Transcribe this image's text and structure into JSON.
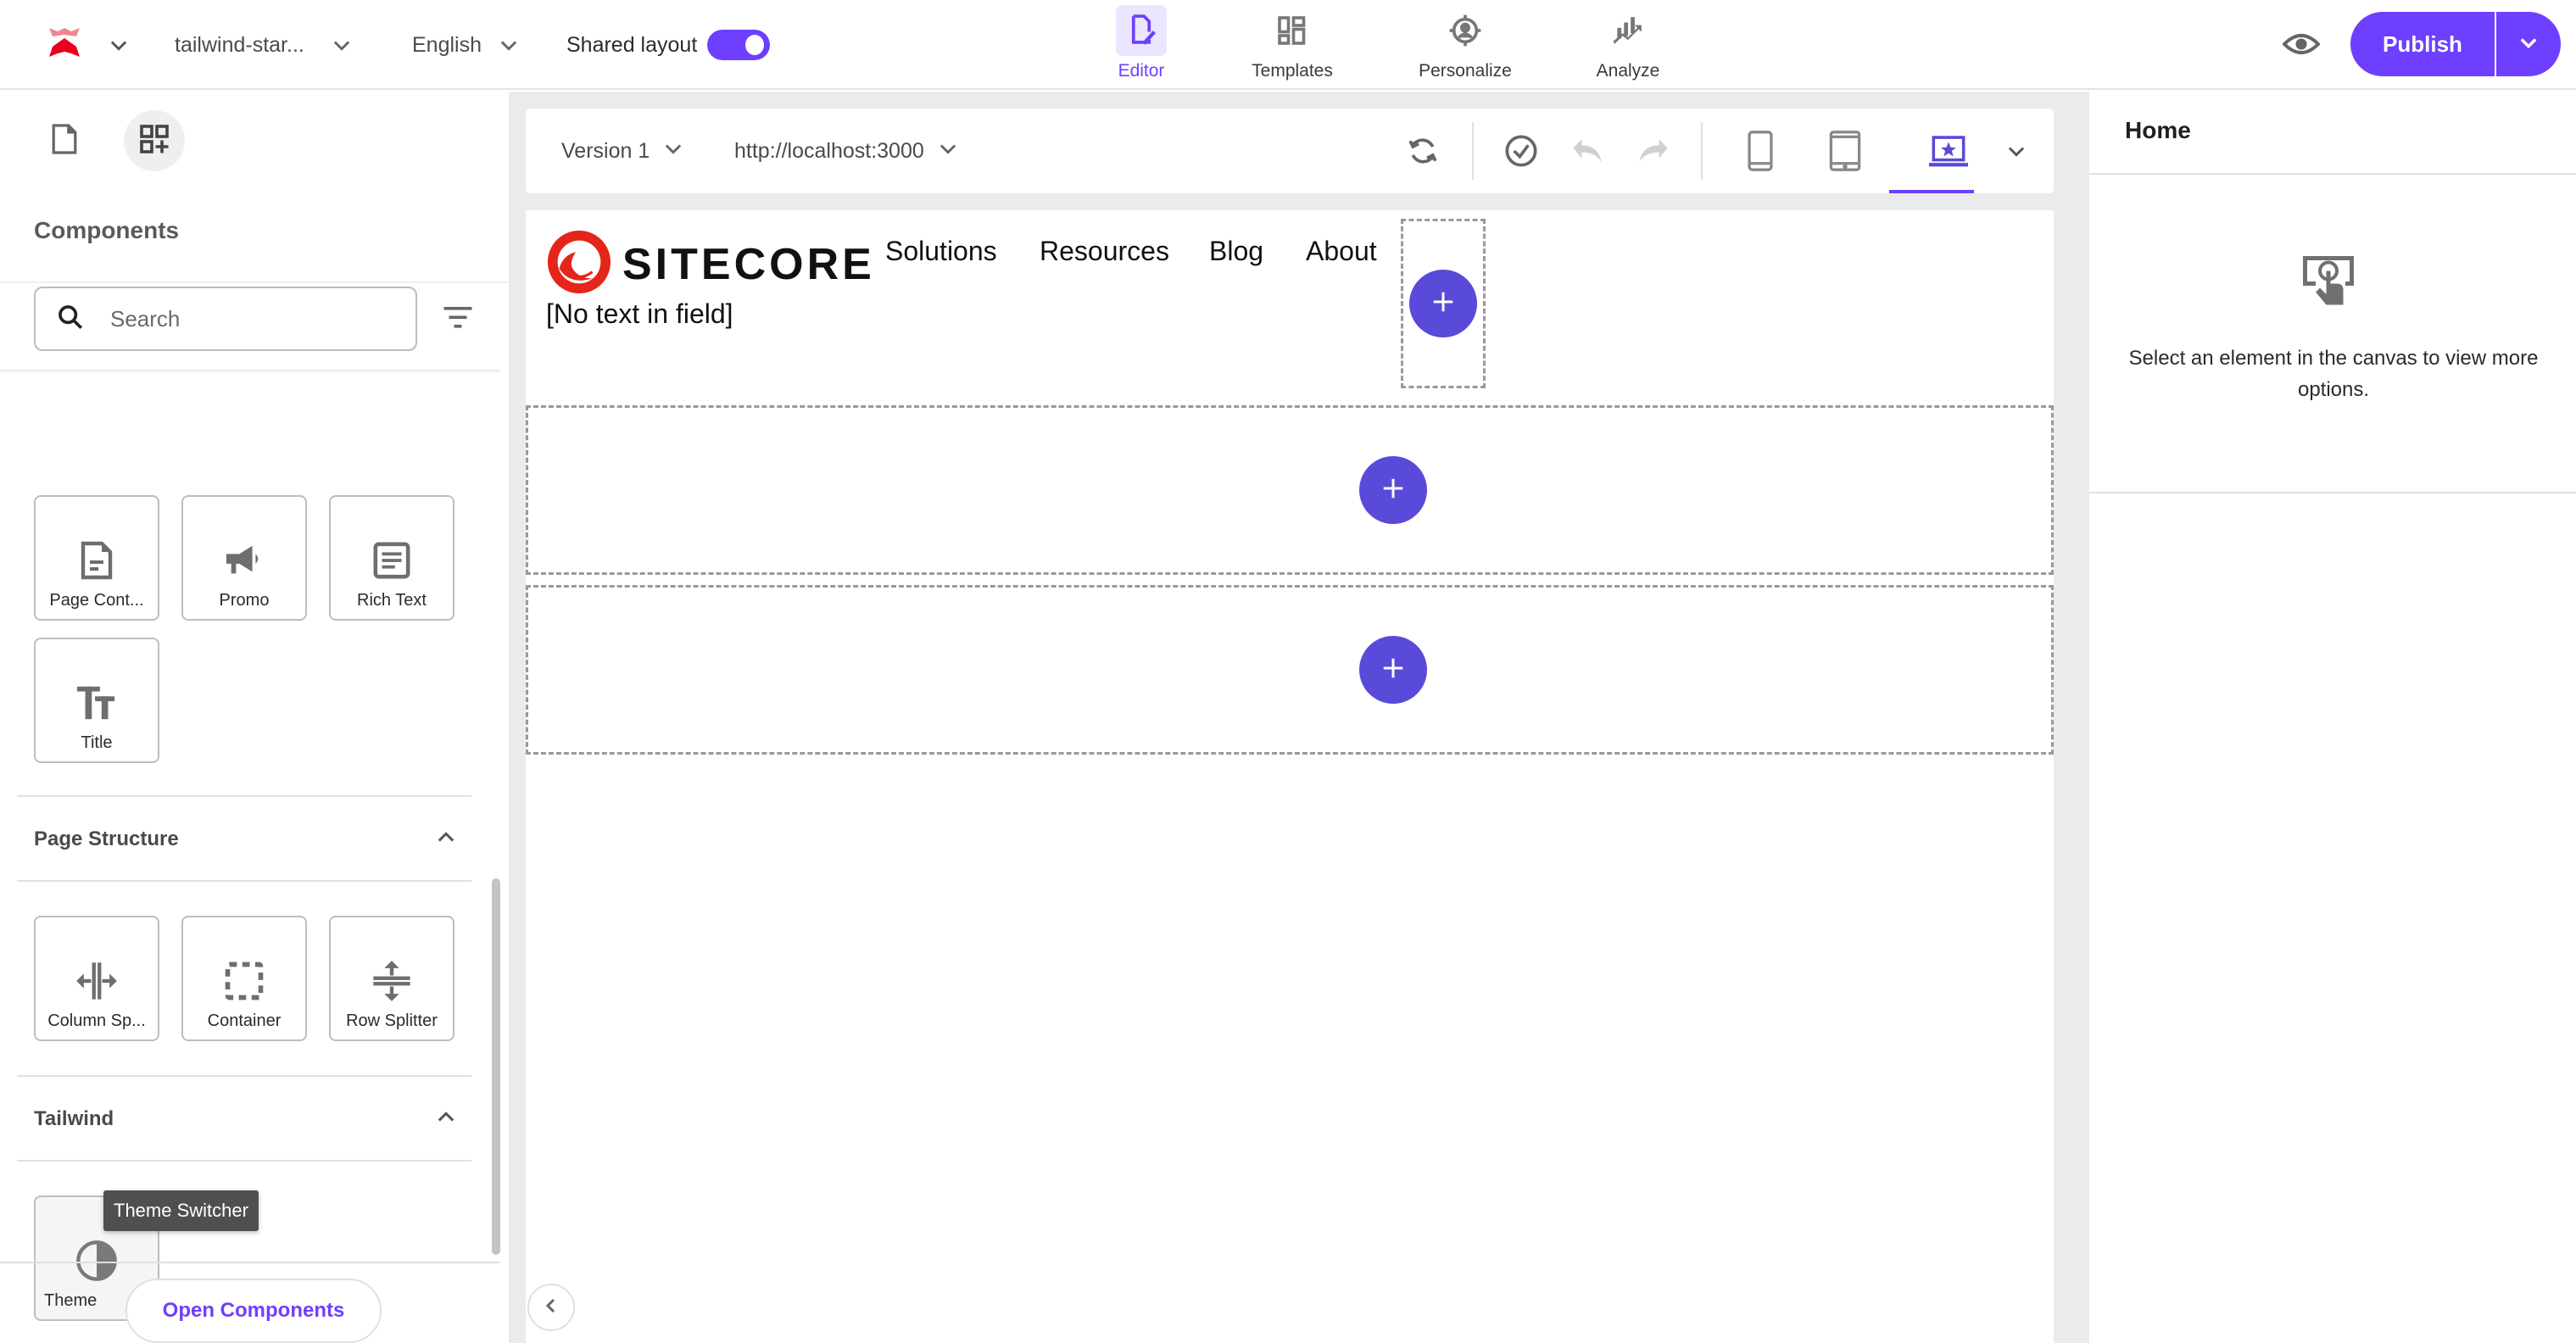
{
  "topbar": {
    "site_name": "tailwind-star...",
    "language": "English",
    "shared_layout_label": "Shared layout",
    "shared_layout_on": true,
    "nav_tabs": [
      {
        "label": "Editor",
        "icon": "editor-icon",
        "active": true
      },
      {
        "label": "Templates",
        "icon": "templates-icon",
        "active": false
      },
      {
        "label": "Personalize",
        "icon": "personalize-icon",
        "active": false
      },
      {
        "label": "Analyze",
        "icon": "analyze-icon",
        "active": false
      }
    ],
    "publish_label": "Publish",
    "accent_color": "#6e3fff"
  },
  "left_panel": {
    "title": "Components",
    "search": {
      "placeholder": "Search",
      "value": ""
    },
    "groups": [
      {
        "label": "",
        "items": [
          {
            "label": "Page Cont...",
            "icon": "page-content-icon"
          },
          {
            "label": "Promo",
            "icon": "megaphone-icon"
          },
          {
            "label": "Rich Text",
            "icon": "rich-text-icon"
          },
          {
            "label": "Title",
            "icon": "title-icon"
          }
        ]
      },
      {
        "label": "Page Structure",
        "expanded": true,
        "items": [
          {
            "label": "Column Sp...",
            "icon": "column-splitter-icon"
          },
          {
            "label": "Container",
            "icon": "container-icon"
          },
          {
            "label": "Row Splitter",
            "icon": "row-splitter-icon"
          }
        ]
      },
      {
        "label": "Tailwind",
        "expanded": true,
        "items": [
          {
            "label": "Theme",
            "icon": "theme-switcher-icon"
          }
        ]
      }
    ],
    "tooltip": "Theme Switcher",
    "open_components_label": "Open Components"
  },
  "canvas_toolbar": {
    "version": "Version 1",
    "url": "http://localhost:3000",
    "active_device": "desktop"
  },
  "canvas": {
    "logo_text": "SITECORE",
    "nav_links": [
      "Solutions",
      "Resources",
      "Blog",
      "About"
    ],
    "empty_field_text": "[No text in field]",
    "add_button_color": "#5a4ad9"
  },
  "right_panel": {
    "title": "Home",
    "empty_message": "Select an element in the canvas to view more options."
  }
}
